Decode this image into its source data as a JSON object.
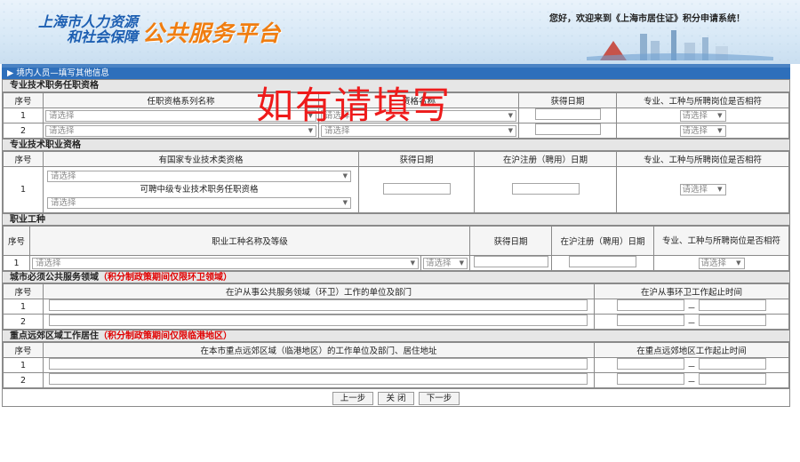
{
  "header": {
    "logo_line1": "上海市人力资源",
    "logo_line2": "和社会保障",
    "logo_main": "公共服务平台",
    "welcome": "您好，欢迎来到《上海市居住证》积分申请系统！"
  },
  "page_title": "▶ 境内人员—填写其他信息",
  "watermark": "如有请填写",
  "placeholder_select": "请选择",
  "sec1": {
    "title": "专业技术职务任职资格",
    "headers": [
      "序号",
      "任职资格系列名称",
      "资格名称",
      "获得日期",
      "专业、工种与所聘岗位是否相符"
    ],
    "rows": [
      "1",
      "2"
    ]
  },
  "sec2": {
    "title": "专业技术职业资格",
    "headers": [
      "序号",
      "有国家专业技术类资格",
      "获得日期",
      "在沪注册（聘用）日期",
      "专业、工种与所聘岗位是否相符"
    ],
    "row_no": "1",
    "mid_text": "可聘中级专业技术职务任职资格"
  },
  "sec3": {
    "title": "职业工种",
    "headers": [
      "序号",
      "职业工种名称及等级",
      "获得日期",
      "在沪注册（聘用）日期",
      "专业、工种与所聘岗位是否相符"
    ],
    "row_no": "1"
  },
  "sec4": {
    "title": "城市必须公共服务领域",
    "note": "（积分制政策期间仅限环卫领域）",
    "headers": [
      "序号",
      "在沪从事公共服务领域（环卫）工作的单位及部门",
      "在沪从事环卫工作起止时间"
    ],
    "rows": [
      "1",
      "2"
    ]
  },
  "sec5": {
    "title": "重点远郊区域工作居住",
    "note": "（积分制政策期间仅限临港地区）",
    "headers": [
      "序号",
      "在本市重点远郊区域（临港地区）的工作单位及部门、居住地址",
      "在重点远郊地区工作起止时间"
    ],
    "rows": [
      "1",
      "2"
    ]
  },
  "dash": "－",
  "buttons": {
    "prev": "上一步",
    "close": "关 闭",
    "next": "下一步"
  },
  "colors": {
    "title_bar": "#2e6fbb",
    "logo_blue": "#1d5fb2",
    "logo_orange": "#f07d10",
    "watermark": "#ee1b1b",
    "note_red": "#e00000"
  }
}
